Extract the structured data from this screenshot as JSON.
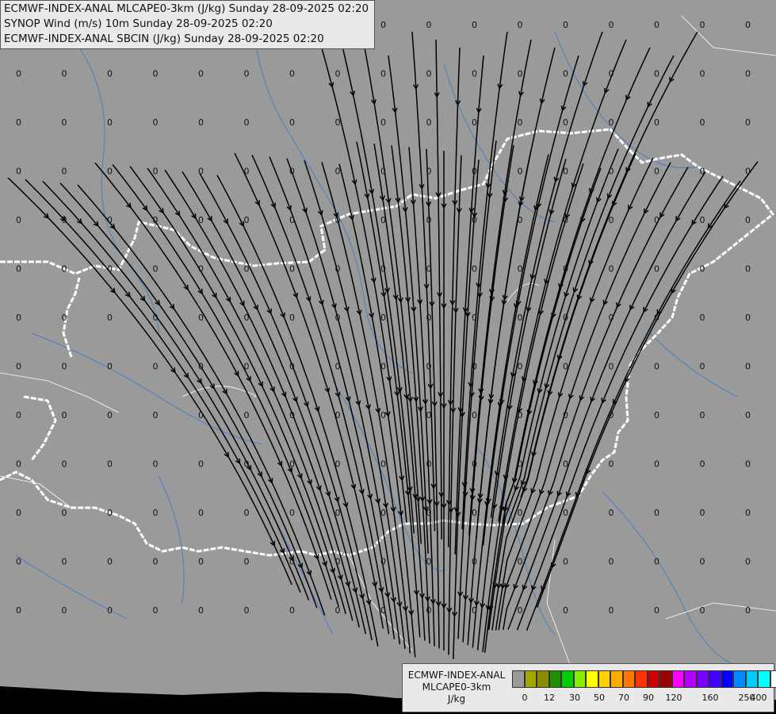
{
  "titles": [
    "ECMWF-INDEX-ANAL MLCAPE0-3km (J/kg) Sunday 28-09-2025 02:20",
    "SYNOP Wind (m/s) 10m Sunday 28-09-2025 02:20",
    "ECMWF-INDEX-ANAL SBCIN (J/kg) Sunday 28-09-2025 02:20"
  ],
  "legend": {
    "line1": "ECMWF-INDEX-ANAL",
    "line2": "MLCAPE0-3km",
    "unit": "J/kg",
    "colors": [
      "#9a9a9a",
      "#a6a600",
      "#8c8c00",
      "#1f8f00",
      "#00cc00",
      "#88ee00",
      "#ffff00",
      "#ffd000",
      "#ffaa00",
      "#ff7700",
      "#ff3300",
      "#cc0000",
      "#990000",
      "#ff00ff",
      "#b400ff",
      "#7a00ff",
      "#4400ff",
      "#0000ff",
      "#0088ff",
      "#00ccff",
      "#00ffff",
      "#ffffff"
    ],
    "ticks": [
      "0",
      "12",
      "30",
      "50",
      "70",
      "90",
      "120",
      "160",
      "250",
      "400"
    ]
  },
  "map": {
    "field_value": "0",
    "colors": {
      "background": "#9a9a9a",
      "border": "#ffffff",
      "river": "#4a7fbf",
      "streamline": "#000000",
      "admin": "#ffffff"
    }
  }
}
